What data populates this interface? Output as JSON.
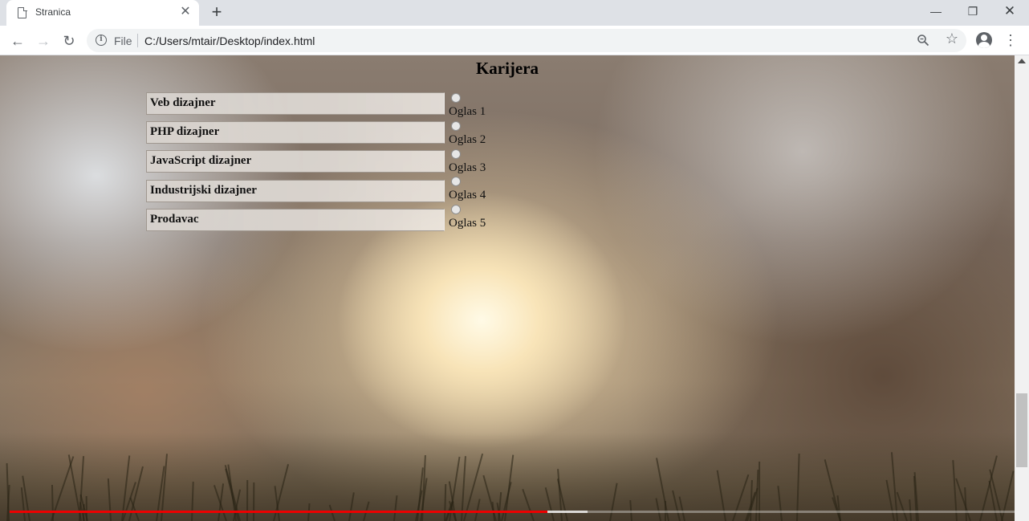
{
  "browser": {
    "tab": {
      "title": "Stranica",
      "icon": "page-icon"
    },
    "toolbar": {
      "scheme_label": "File",
      "url": "C:/Users/mtair/Desktop/index.html"
    }
  },
  "page": {
    "heading": "Karijera",
    "jobs": [
      {
        "label": "Veb dizajner"
      },
      {
        "label": "PHP dizajner"
      },
      {
        "label": "JavaScript dizajner"
      },
      {
        "label": "Industrijski dizajner"
      },
      {
        "label": "Prodavac"
      }
    ],
    "ads": [
      {
        "label": "Oglas 1",
        "checked": false
      },
      {
        "label": "Oglas 2",
        "checked": false
      },
      {
        "label": "Oglas 3",
        "checked": false
      },
      {
        "label": "Oglas 4",
        "checked": false
      },
      {
        "label": "Oglas 5",
        "checked": false
      }
    ]
  },
  "video_overlay": {
    "progress_played_fraction": 0.535,
    "progress_buffered_fraction": 0.575,
    "progress_color": "#ee0000"
  }
}
